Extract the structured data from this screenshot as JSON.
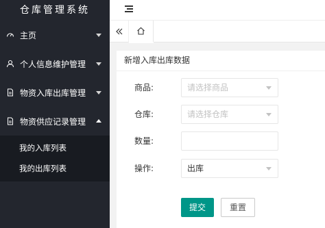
{
  "app": {
    "title": "仓库管理系统"
  },
  "sidebar": {
    "items": [
      {
        "label": "主页",
        "icon": "dashboard-icon"
      },
      {
        "label": "个人信息维护管理",
        "icon": "user-icon"
      },
      {
        "label": "物资入库出库管理",
        "icon": "document-icon"
      },
      {
        "label": "物资供应记录管理",
        "icon": "document-icon",
        "expanded": true
      }
    ],
    "submenu": [
      {
        "label": "我的入库列表"
      },
      {
        "label": "我的出库列表"
      }
    ]
  },
  "tabs": {
    "home_icon": "home-icon"
  },
  "form": {
    "title": "新增入库出库数据",
    "product": {
      "label": "商品:",
      "placeholder": "请选择商品"
    },
    "warehouse": {
      "label": "仓库:",
      "placeholder": "请选择仓库"
    },
    "quantity": {
      "label": "数量:",
      "value": ""
    },
    "operation": {
      "label": "操作:",
      "value": "出库"
    },
    "submit_label": "提交",
    "reset_label": "重置"
  },
  "colors": {
    "sidebar": "#23262e",
    "submenu": "#181b21",
    "accent": "#009688"
  }
}
